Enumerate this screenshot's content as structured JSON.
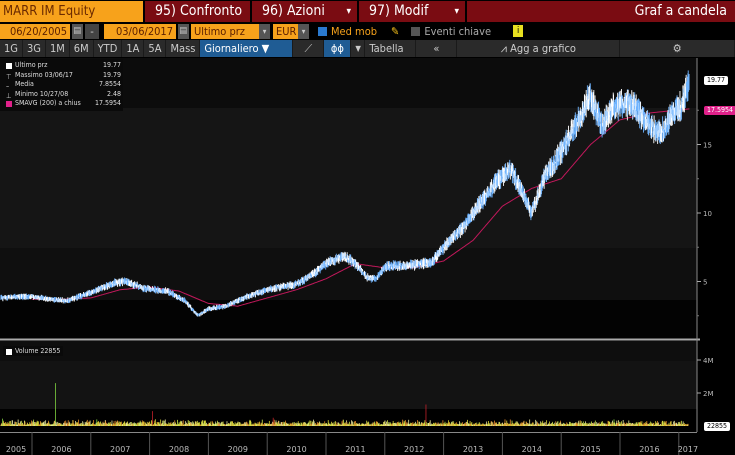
{
  "header": {
    "ticker": "MARR IM Equity",
    "compare": "95) Confronto",
    "actions": "96) Azioni",
    "modify": "97) Modif",
    "chart_type": "Graf a candela"
  },
  "controls": {
    "start_date": "06/20/2005",
    "dash": "-",
    "end_date": "03/06/2017",
    "field": "Ultimo prz",
    "currency": "EUR",
    "moving_avg": "Med mob",
    "key_events": "Eventi chiave",
    "info": "i"
  },
  "periods": [
    "1G",
    "3G",
    "1M",
    "6M",
    "YTD",
    "1A",
    "5A",
    "Mass"
  ],
  "frequency": "Giornaliero ▼",
  "table": "Tabella",
  "back": "«",
  "add_to_chart": "Agg a grafico",
  "settings": "⚙",
  "legend": [
    {
      "label": "Ultimo prz",
      "value": "19.77",
      "color": "#ffffff"
    },
    {
      "label": "Massimo 03/06/17",
      "value": "19.79"
    },
    {
      "label": "Media",
      "value": "7.8554"
    },
    {
      "label": "Minimo 10/27/08",
      "value": "2.48"
    },
    {
      "label": "SMAVG (200) a chius",
      "value": "17.5954",
      "color": "#e0218a"
    }
  ],
  "volume_legend": "Volume 22855",
  "chart_data": {
    "type": "line",
    "title": "MARR IM Equity",
    "x_range": [
      2005.47,
      2017.18
    ],
    "price_ylim": [
      0,
      21
    ],
    "price_ticks": [
      5,
      10,
      15
    ],
    "last_price_tag": "19.77",
    "ma_tag": "17.5954",
    "volume_ticks": [
      {
        "v": 2000000,
        "label": "2M"
      },
      {
        "v": 4000000,
        "label": "4M"
      }
    ],
    "volume_tag": "22855",
    "x_tick_labels": [
      "2005",
      "2006",
      "2007",
      "2008",
      "2009",
      "2010",
      "2011",
      "2012",
      "2013",
      "2014",
      "2015",
      "2016",
      "2017"
    ],
    "series": [
      {
        "name": "Ultimo prz",
        "color": "#9fd0ff",
        "points": [
          [
            2005.47,
            3.8
          ],
          [
            2005.8,
            3.9
          ],
          [
            2006.0,
            3.9
          ],
          [
            2006.3,
            3.7
          ],
          [
            2006.6,
            3.6
          ],
          [
            2007.0,
            4.2
          ],
          [
            2007.4,
            4.9
          ],
          [
            2007.6,
            5.0
          ],
          [
            2007.9,
            4.5
          ],
          [
            2008.3,
            4.3
          ],
          [
            2008.6,
            3.6
          ],
          [
            2008.82,
            2.5
          ],
          [
            2009.0,
            3.0
          ],
          [
            2009.3,
            3.2
          ],
          [
            2009.6,
            3.8
          ],
          [
            2010.0,
            4.4
          ],
          [
            2010.5,
            4.8
          ],
          [
            2010.8,
            5.6
          ],
          [
            2011.0,
            6.3
          ],
          [
            2011.3,
            6.9
          ],
          [
            2011.5,
            6.3
          ],
          [
            2011.7,
            5.3
          ],
          [
            2011.85,
            5.2
          ],
          [
            2012.0,
            6.1
          ],
          [
            2012.5,
            6.2
          ],
          [
            2012.8,
            6.4
          ],
          [
            2013.0,
            7.5
          ],
          [
            2013.3,
            8.8
          ],
          [
            2013.6,
            10.6
          ],
          [
            2013.9,
            12.3
          ],
          [
            2014.15,
            13.2
          ],
          [
            2014.35,
            11.3
          ],
          [
            2014.5,
            10.0
          ],
          [
            2014.7,
            12.4
          ],
          [
            2015.0,
            14.5
          ],
          [
            2015.3,
            16.8
          ],
          [
            2015.5,
            18.6
          ],
          [
            2015.7,
            16.3
          ],
          [
            2015.9,
            17.8
          ],
          [
            2016.2,
            18.0
          ],
          [
            2016.45,
            16.6
          ],
          [
            2016.7,
            15.8
          ],
          [
            2016.9,
            17.2
          ],
          [
            2017.05,
            17.8
          ],
          [
            2017.18,
            19.77
          ]
        ]
      },
      {
        "name": "SMAVG (200) a chius",
        "color": "#c2185b",
        "points": [
          [
            2006.0,
            3.7
          ],
          [
            2006.5,
            3.7
          ],
          [
            2007.0,
            3.8
          ],
          [
            2007.5,
            4.4
          ],
          [
            2008.0,
            4.6
          ],
          [
            2008.5,
            4.3
          ],
          [
            2009.0,
            3.4
          ],
          [
            2009.5,
            3.2
          ],
          [
            2010.0,
            3.8
          ],
          [
            2010.5,
            4.4
          ],
          [
            2011.0,
            5.2
          ],
          [
            2011.5,
            6.3
          ],
          [
            2012.0,
            6.0
          ],
          [
            2012.5,
            6.0
          ],
          [
            2013.0,
            6.5
          ],
          [
            2013.5,
            8.0
          ],
          [
            2014.0,
            10.5
          ],
          [
            2014.5,
            11.8
          ],
          [
            2015.0,
            12.5
          ],
          [
            2015.5,
            15.0
          ],
          [
            2016.0,
            16.8
          ],
          [
            2016.5,
            17.3
          ],
          [
            2017.18,
            17.6
          ]
        ]
      },
      {
        "name": "Volume",
        "points": [
          [
            2006.4,
            2600000
          ],
          [
            2008.05,
            900000
          ],
          [
            2012.7,
            1300000
          ],
          [
            2015.9,
            400000
          ],
          [
            2010.1,
            500000
          ],
          [
            2007.1,
            400000
          ],
          [
            2005.5,
            450000
          ]
        ]
      }
    ]
  }
}
